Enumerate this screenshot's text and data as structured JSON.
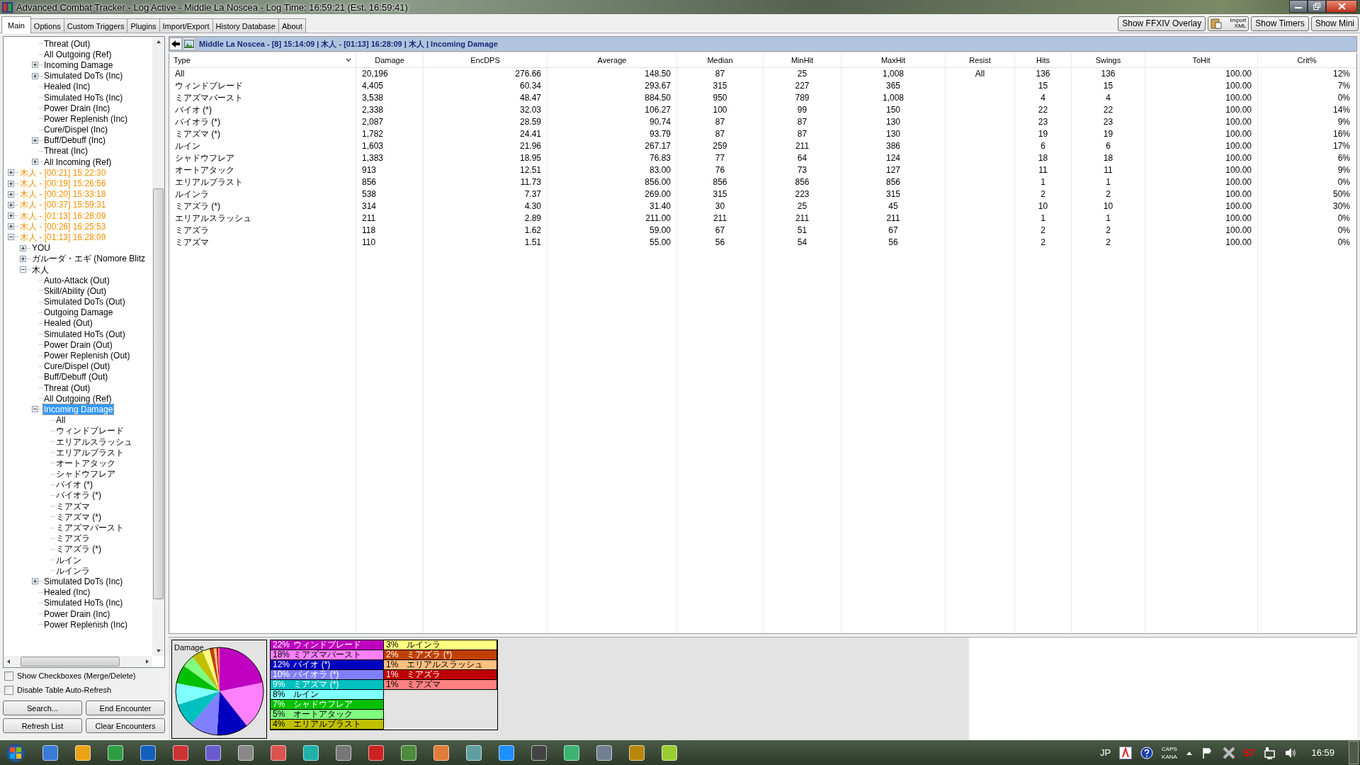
{
  "window": {
    "title": "Advanced Combat Tracker - Log Active - Middle La Noscea - Log Time: 16:59:21 (Est. 16:59:41)"
  },
  "tabs": [
    {
      "label": "Main",
      "selected": true
    },
    {
      "label": "Options",
      "selected": false
    },
    {
      "label": "Custom Triggers",
      "selected": false
    },
    {
      "label": "Plugins",
      "selected": false
    },
    {
      "label": "Import/Export",
      "selected": false
    },
    {
      "label": "History Database",
      "selected": false
    },
    {
      "label": "About",
      "selected": false
    }
  ],
  "toolbar": {
    "overlay_button": "Show FFXIV Overlay",
    "import_button": "Import XML",
    "timers_button": "Show Timers",
    "mini_button": "Show Mini"
  },
  "tree": {
    "partial": [
      {
        "label": "Threat (Out)",
        "selected": false
      },
      {
        "label": "All Outgoing (Ref)",
        "selected": false
      },
      {
        "label": "Incoming Damage",
        "selected": false,
        "expanded": false
      },
      {
        "label": "Simulated DoTs (Inc)",
        "selected": false,
        "expanded": false
      },
      {
        "label": "Healed (Inc)",
        "selected": false
      },
      {
        "label": "Simulated HoTs (Inc)",
        "selected": false
      },
      {
        "label": "Power Drain (Inc)",
        "selected": false
      },
      {
        "label": "Power Replenish (Inc)",
        "selected": false
      },
      {
        "label": "Cure/Dispel (Inc)",
        "selected": false
      },
      {
        "label": "Buff/Debuff (Inc)",
        "selected": false,
        "expanded": false
      },
      {
        "label": "Threat (Inc)",
        "selected": false
      },
      {
        "label": "All Incoming (Ref)",
        "selected": false,
        "expanded": false
      }
    ],
    "encounters": [
      {
        "label": "木人 - [00:21] 15:22:30",
        "selected": false,
        "expanded": false
      },
      {
        "label": "木人 - [00:19] 15:26:56",
        "selected": false,
        "expanded": false
      },
      {
        "label": "木人 - [00:20] 15:33:18",
        "selected": false,
        "expanded": false
      },
      {
        "label": "木人 - [00:37] 15:59:31",
        "selected": false,
        "expanded": false
      },
      {
        "label": "木人 - [01:13] 16:28:09",
        "selected": false,
        "expanded": false
      },
      {
        "label": "木人 - [00:26] 16:25:53",
        "selected": false,
        "expanded": false
      },
      {
        "label": "木人 - [01:13] 16:28:09",
        "selected": false,
        "expanded": true,
        "children": [
          {
            "label": "YOU",
            "selected": false,
            "expanded": false
          },
          {
            "label": "ガルーダ・エギ (Nomore Blitz",
            "selected": false,
            "expanded": false
          },
          {
            "label": "木人",
            "selected": false,
            "expanded": true,
            "children": [
              {
                "label": "Auto-Attack (Out)",
                "selected": false
              },
              {
                "label": "Skill/Ability (Out)",
                "selected": false
              },
              {
                "label": "Simulated DoTs (Out)",
                "selected": false
              },
              {
                "label": "Outgoing Damage",
                "selected": false
              },
              {
                "label": "Healed (Out)",
                "selected": false
              },
              {
                "label": "Simulated HoTs (Out)",
                "selected": false
              },
              {
                "label": "Power Drain (Out)",
                "selected": false
              },
              {
                "label": "Power Replenish (Out)",
                "selected": false
              },
              {
                "label": "Cure/Dispel (Out)",
                "selected": false
              },
              {
                "label": "Buff/Debuff (Out)",
                "selected": false
              },
              {
                "label": "Threat (Out)",
                "selected": false
              },
              {
                "label": "All Outgoing (Ref)",
                "selected": false
              },
              {
                "label": "Incoming Damage",
                "selected": true,
                "expanded": true,
                "children": [
                  {
                    "label": "All",
                    "selected": false
                  },
                  {
                    "label": "ウィンドブレード",
                    "selected": false
                  },
                  {
                    "label": "エリアルスラッシュ",
                    "selected": false
                  },
                  {
                    "label": "エリアルブラスト",
                    "selected": false
                  },
                  {
                    "label": "オートアタック",
                    "selected": false
                  },
                  {
                    "label": "シャドウフレア",
                    "selected": false
                  },
                  {
                    "label": "バイオ (*)",
                    "selected": false
                  },
                  {
                    "label": "バイオラ (*)",
                    "selected": false
                  },
                  {
                    "label": "ミアズマ",
                    "selected": false
                  },
                  {
                    "label": "ミアズマ (*)",
                    "selected": false
                  },
                  {
                    "label": "ミアズマバースト",
                    "selected": false
                  },
                  {
                    "label": "ミアズラ",
                    "selected": false
                  },
                  {
                    "label": "ミアズラ (*)",
                    "selected": false
                  },
                  {
                    "label": "ルイン",
                    "selected": false
                  },
                  {
                    "label": "ルインラ",
                    "selected": false
                  }
                ]
              },
              {
                "label": "Simulated DoTs (Inc)",
                "selected": false,
                "expanded": false
              },
              {
                "label": "Healed (Inc)",
                "selected": false
              },
              {
                "label": "Simulated HoTs (Inc)",
                "selected": false
              },
              {
                "label": "Power Drain (Inc)",
                "selected": false
              },
              {
                "label": "Power Replenish (Inc)",
                "selected": false
              }
            ]
          }
        ]
      }
    ]
  },
  "options": [
    {
      "label": "Show Checkboxes (Merge/Delete)",
      "checked": false
    },
    {
      "label": "Disable Table Auto-Refresh",
      "checked": false
    }
  ],
  "buttons": [
    "Search...",
    "End Encounter",
    "Refresh List",
    "Clear Encounters"
  ],
  "breadcrumb": "Middle La Noscea - [8] 15:14:09 | 木人 - [01:13] 16:28:09 | 木人 | Incoming Damage",
  "table": {
    "columns": [
      {
        "label": "Type",
        "sorted": true
      },
      {
        "label": "Damage",
        "sorted": false
      },
      {
        "label": "EncDPS",
        "sorted": false
      },
      {
        "label": "Average",
        "sorted": false
      },
      {
        "label": "Median",
        "sorted": false
      },
      {
        "label": "MinHit",
        "sorted": false
      },
      {
        "label": "MaxHit",
        "sorted": false
      },
      {
        "label": "Resist",
        "sorted": false
      },
      {
        "label": "Hits",
        "sorted": false
      },
      {
        "label": "Swings",
        "sorted": false
      },
      {
        "label": "ToHit",
        "sorted": false
      },
      {
        "label": "Crit%",
        "sorted": false
      }
    ],
    "rows": [
      {
        "type": "All",
        "damage": "20,196",
        "encdps": "276.66",
        "average": "148.50",
        "median": "87",
        "minhit": "25",
        "maxhit": "1,008",
        "resist": "All",
        "hits": "136",
        "swings": "136",
        "tohit": "100.00",
        "crit": "12%"
      },
      {
        "type": "ウィンドブレード",
        "damage": "4,405",
        "encdps": "60.34",
        "average": "293.67",
        "median": "315",
        "minhit": "227",
        "maxhit": "365",
        "hits": "15",
        "swings": "15",
        "tohit": "100.00",
        "crit": "7%"
      },
      {
        "type": "ミアズマバースト",
        "damage": "3,538",
        "encdps": "48.47",
        "average": "884.50",
        "median": "950",
        "minhit": "789",
        "maxhit": "1,008",
        "hits": "4",
        "swings": "4",
        "tohit": "100.00",
        "crit": "0%"
      },
      {
        "type": "バイオ (*)",
        "damage": "2,338",
        "encdps": "32.03",
        "average": "106.27",
        "median": "100",
        "minhit": "99",
        "maxhit": "150",
        "hits": "22",
        "swings": "22",
        "tohit": "100.00",
        "crit": "14%"
      },
      {
        "type": "バイオラ (*)",
        "damage": "2,087",
        "encdps": "28.59",
        "average": "90.74",
        "median": "87",
        "minhit": "87",
        "maxhit": "130",
        "hits": "23",
        "swings": "23",
        "tohit": "100.00",
        "crit": "9%"
      },
      {
        "type": "ミアズマ (*)",
        "damage": "1,782",
        "encdps": "24.41",
        "average": "93.79",
        "median": "87",
        "minhit": "87",
        "maxhit": "130",
        "hits": "19",
        "swings": "19",
        "tohit": "100.00",
        "crit": "16%"
      },
      {
        "type": "ルイン",
        "damage": "1,603",
        "encdps": "21.96",
        "average": "267.17",
        "median": "259",
        "minhit": "211",
        "maxhit": "386",
        "hits": "6",
        "swings": "6",
        "tohit": "100.00",
        "crit": "17%"
      },
      {
        "type": "シャドウフレア",
        "damage": "1,383",
        "encdps": "18.95",
        "average": "76.83",
        "median": "77",
        "minhit": "64",
        "maxhit": "124",
        "hits": "18",
        "swings": "18",
        "tohit": "100.00",
        "crit": "6%"
      },
      {
        "type": "オートアタック",
        "damage": "913",
        "encdps": "12.51",
        "average": "83.00",
        "median": "76",
        "minhit": "73",
        "maxhit": "127",
        "hits": "11",
        "swings": "11",
        "tohit": "100.00",
        "crit": "9%"
      },
      {
        "type": "エリアルブラスト",
        "damage": "856",
        "encdps": "11.73",
        "average": "856.00",
        "median": "856",
        "minhit": "856",
        "maxhit": "856",
        "hits": "1",
        "swings": "1",
        "tohit": "100.00",
        "crit": "0%"
      },
      {
        "type": "ルインラ",
        "damage": "538",
        "encdps": "7.37",
        "average": "269.00",
        "median": "315",
        "minhit": "223",
        "maxhit": "315",
        "hits": "2",
        "swings": "2",
        "tohit": "100.00",
        "crit": "50%"
      },
      {
        "type": "ミアズラ (*)",
        "damage": "314",
        "encdps": "4.30",
        "average": "31.40",
        "median": "30",
        "minhit": "25",
        "maxhit": "45",
        "hits": "10",
        "swings": "10",
        "tohit": "100.00",
        "crit": "30%"
      },
      {
        "type": "エリアルスラッシュ",
        "damage": "211",
        "encdps": "2.89",
        "average": "211.00",
        "median": "211",
        "minhit": "211",
        "maxhit": "211",
        "hits": "1",
        "swings": "1",
        "tohit": "100.00",
        "crit": "0%"
      },
      {
        "type": "ミアズラ",
        "damage": "118",
        "encdps": "1.62",
        "average": "59.00",
        "median": "67",
        "minhit": "51",
        "maxhit": "67",
        "hits": "2",
        "swings": "2",
        "tohit": "100.00",
        "crit": "0%"
      },
      {
        "type": "ミアズマ",
        "damage": "110",
        "encdps": "1.51",
        "average": "55.00",
        "median": "56",
        "minhit": "54",
        "maxhit": "56",
        "hits": "2",
        "swings": "2",
        "tohit": "100.00",
        "crit": "0%"
      }
    ]
  },
  "pie": {
    "chart_data": {
      "type": "pie",
      "title": "Damage",
      "categories": [
        "ウィンドブレード",
        "ミアズマバースト",
        "バイオ (*)",
        "バイオラ (*)",
        "ミアズマ (*)",
        "ルイン",
        "シャドウフレア",
        "オートアタック",
        "エリアルブラスト",
        "ルインラ",
        "ミアズラ (*)",
        "エリアルスラッシュ",
        "ミアズラ",
        "ミアズマ"
      ],
      "values": [
        21.83,
        17.52,
        11.58,
        10.33,
        8.82,
        7.94,
        6.85,
        4.52,
        4.24,
        2.66,
        1.55,
        1.04,
        0.58,
        0.54
      ]
    },
    "legend": [
      {
        "percent": "22%",
        "color": "#c000c0"
      },
      {
        "percent": "18%",
        "color": "#ff80ff"
      },
      {
        "percent": "12%",
        "color": "#0000c0"
      },
      {
        "percent": "10%",
        "color": "#8080ff"
      },
      {
        "percent": "9%",
        "color": "#00c0c0"
      },
      {
        "percent": "8%",
        "color": "#80ffff"
      },
      {
        "percent": "7%",
        "color": "#00c000"
      },
      {
        "percent": "5%",
        "color": "#80ff80"
      },
      {
        "percent": "4%",
        "color": "#c0c000"
      },
      {
        "percent": "3%",
        "color": "#ffff80"
      },
      {
        "percent": "2%",
        "color": "#c04000"
      },
      {
        "percent": "1%",
        "color": "#ffc080"
      },
      {
        "percent": "1%",
        "color": "#c00000"
      },
      {
        "percent": "1%",
        "color": "#ff8080"
      }
    ]
  },
  "tray": {
    "language": "JP",
    "caps": "CAPS",
    "kana": "KANA",
    "counter": "57",
    "clock": "16:59"
  }
}
